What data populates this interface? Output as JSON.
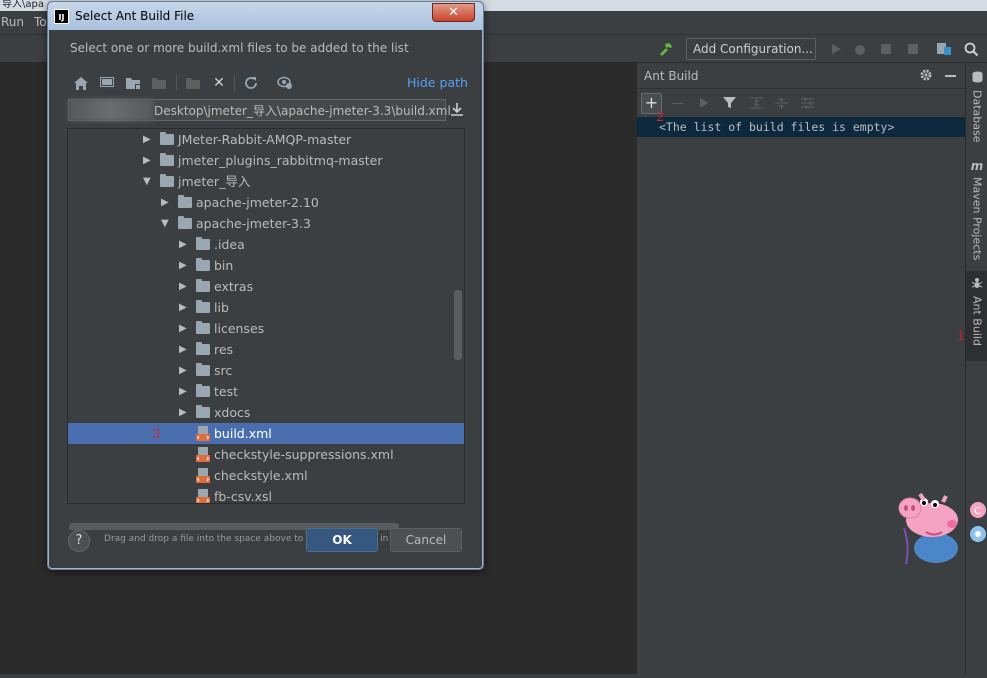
{
  "window": {
    "title_fragment": "导入\\apa"
  },
  "menu": {
    "items": [
      "Run",
      "To"
    ]
  },
  "toolbar": {
    "run_config_label": "Add Configuration..."
  },
  "dialog": {
    "title": "Select Ant Build File",
    "description": "Select one or more build.xml files to be added to the list",
    "hide_path_label": "Hide path",
    "path_value": "Desktop\\jmeter_导入\\apache-jmeter-3.3\\build.xml",
    "tree": [
      {
        "label": "JMeter-Rabbit-AMQP-master",
        "depth": 0,
        "expanded": false,
        "type": "folder"
      },
      {
        "label": "jmeter_plugins_rabbitmq-master",
        "depth": 0,
        "expanded": false,
        "type": "folder"
      },
      {
        "label": "jmeter_导入",
        "depth": 0,
        "expanded": true,
        "type": "folder"
      },
      {
        "label": "apache-jmeter-2.10",
        "depth": 1,
        "expanded": false,
        "type": "folder"
      },
      {
        "label": "apache-jmeter-3.3",
        "depth": 1,
        "expanded": true,
        "type": "folder"
      },
      {
        "label": ".idea",
        "depth": 2,
        "expanded": false,
        "type": "folder"
      },
      {
        "label": "bin",
        "depth": 2,
        "expanded": false,
        "type": "folder"
      },
      {
        "label": "extras",
        "depth": 2,
        "expanded": false,
        "type": "folder"
      },
      {
        "label": "lib",
        "depth": 2,
        "expanded": false,
        "type": "folder"
      },
      {
        "label": "licenses",
        "depth": 2,
        "expanded": false,
        "type": "folder"
      },
      {
        "label": "res",
        "depth": 2,
        "expanded": false,
        "type": "folder"
      },
      {
        "label": "src",
        "depth": 2,
        "expanded": false,
        "type": "folder"
      },
      {
        "label": "test",
        "depth": 2,
        "expanded": false,
        "type": "folder"
      },
      {
        "label": "xdocs",
        "depth": 2,
        "expanded": false,
        "type": "folder"
      },
      {
        "label": "build.xml",
        "depth": 2,
        "type": "file",
        "selected": true
      },
      {
        "label": "checkstyle-suppressions.xml",
        "depth": 2,
        "type": "file"
      },
      {
        "label": "checkstyle.xml",
        "depth": 2,
        "type": "file"
      },
      {
        "label": "fb-csv.xsl",
        "depth": 2,
        "type": "file"
      }
    ],
    "hint": "Drag and drop a file into the space above to quickly locate it in the tree",
    "help_label": "?",
    "ok_label": "OK",
    "cancel_label": "Cancel"
  },
  "ant_panel": {
    "title": "Ant Build",
    "empty_message": "<The list of build files is empty>"
  },
  "right_tabs": [
    "Database",
    "Maven Projects",
    "Ant Build"
  ],
  "annotations": {
    "mark1": "1",
    "mark2": "2",
    "mark3": "3"
  },
  "colors": {
    "selection": "#4b6eaf",
    "link": "#589df6",
    "panel": "#3c3f41",
    "editor": "#2b2b2b"
  }
}
